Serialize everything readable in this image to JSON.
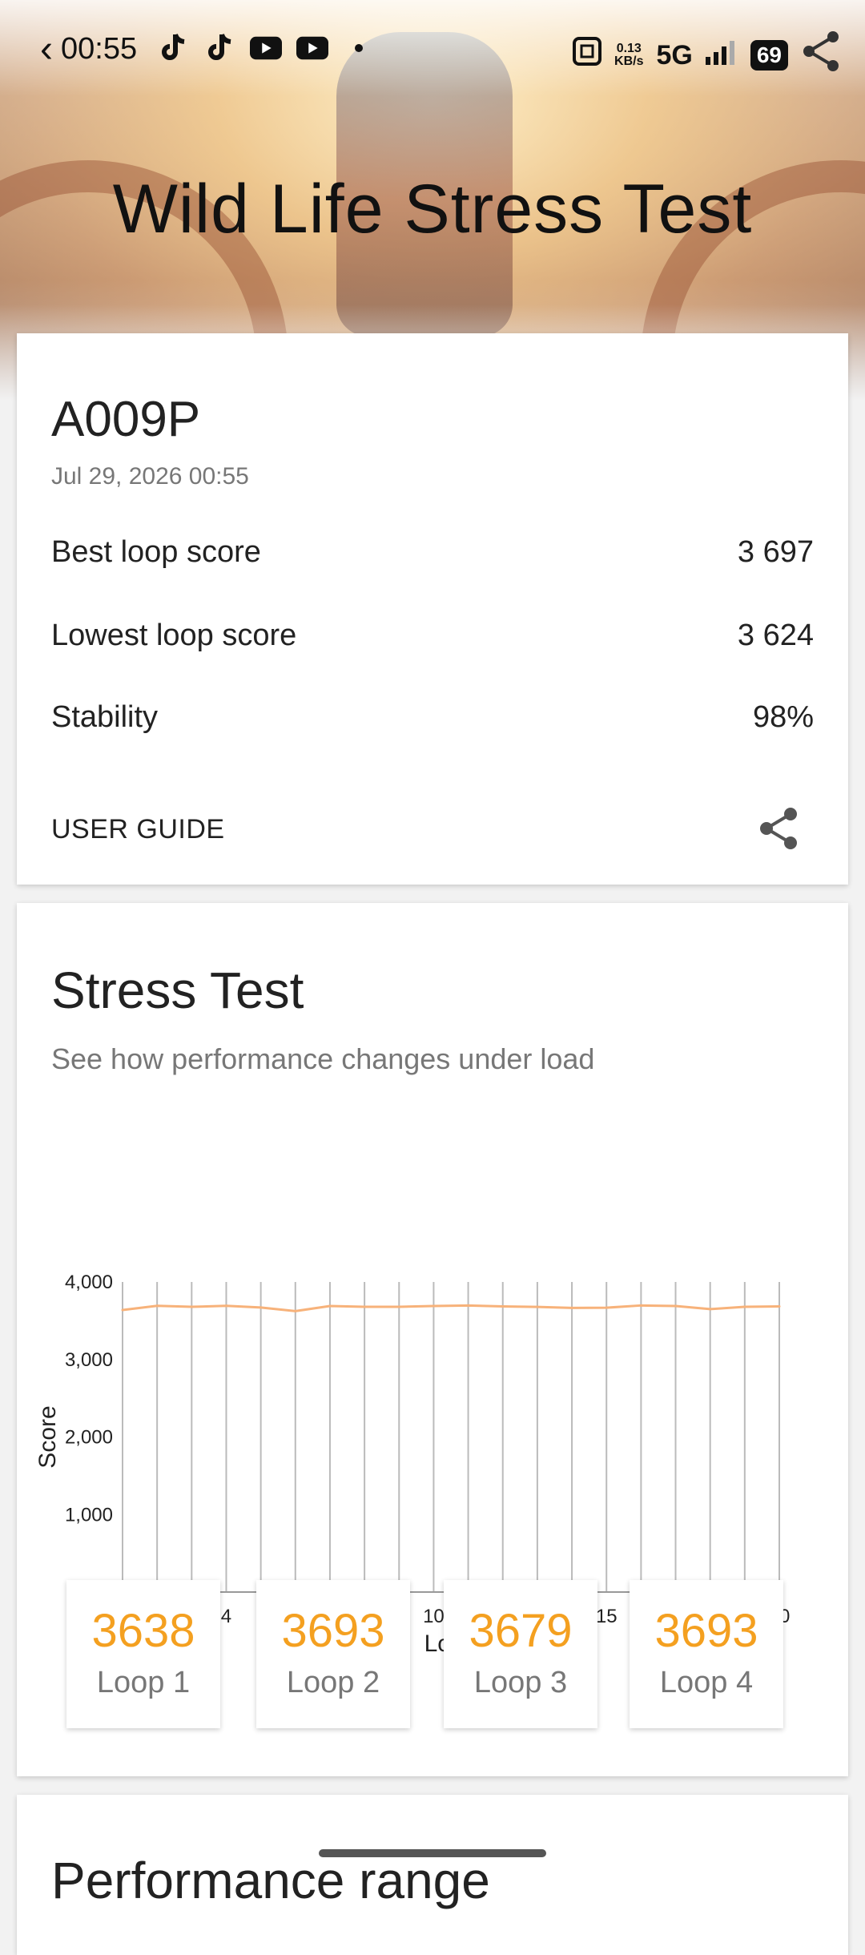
{
  "status_bar": {
    "time": "00:55",
    "apps": [
      "tiktok-icon",
      "tiktok-icon",
      "youtube-icon",
      "youtube-icon",
      "dot-icon"
    ],
    "net_speed_value": "0.13",
    "net_speed_unit": "KB/s",
    "network": "5G",
    "battery": "69"
  },
  "hero": {
    "title": "Wild Life Stress Test"
  },
  "summary": {
    "device": "A009P",
    "date": "Jul 29, 2026 00:55",
    "rows": [
      {
        "label": "Best loop score",
        "value": "3 697"
      },
      {
        "label": "Lowest loop score",
        "value": "3 624"
      },
      {
        "label": "Stability",
        "value": "98%"
      }
    ],
    "user_guide": "USER GUIDE"
  },
  "stress": {
    "title": "Stress Test",
    "subtitle": "See how performance changes under load",
    "loops": [
      {
        "value": "3638",
        "label": "Loop 1"
      },
      {
        "value": "3693",
        "label": "Loop 2"
      },
      {
        "value": "3679",
        "label": "Loop 3"
      },
      {
        "value": "3693",
        "label": "Loop 4"
      }
    ]
  },
  "chart_data": {
    "type": "line",
    "xlabel": "Loop",
    "ylabel": "Score",
    "x": [
      1,
      2,
      3,
      4,
      5,
      6,
      7,
      8,
      9,
      10,
      11,
      12,
      13,
      14,
      15,
      16,
      17,
      18,
      19,
      20
    ],
    "ylim": [
      0,
      4000
    ],
    "yticks": [
      0,
      1000,
      2000,
      3000,
      4000
    ],
    "ytick_labels": [
      "0",
      "1,000",
      "2,000",
      "3,000",
      "4,000"
    ],
    "series": [
      {
        "values": [
          3638,
          3693,
          3679,
          3693,
          3670,
          3624,
          3690,
          3680,
          3680,
          3690,
          3697,
          3685,
          3678,
          3665,
          3668,
          3697,
          3690,
          3650,
          3680,
          3685
        ],
        "color": "#f7b27a"
      }
    ],
    "grid": "vertical"
  },
  "next_section": {
    "title": "Performance range"
  }
}
